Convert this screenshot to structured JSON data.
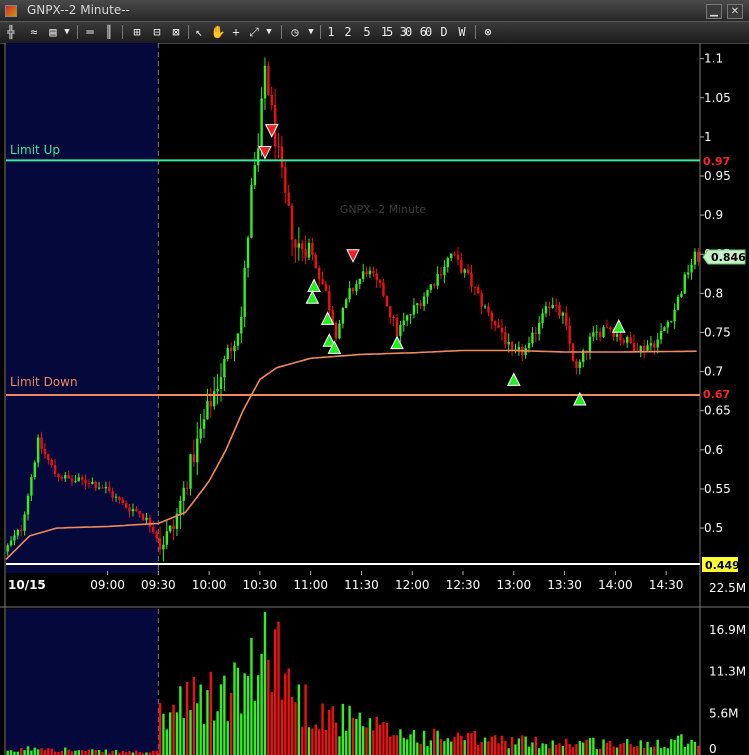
{
  "window": {
    "title": "GNPX--2 Minute--"
  },
  "toolbar": {
    "intervals": [
      "1",
      "2",
      "5",
      "15",
      "30",
      "60",
      "D",
      "W"
    ]
  },
  "colors": {
    "up": "#33ee22",
    "down": "#ee1111",
    "vwap": "#f08a5d",
    "limit_up": "#3ee89a",
    "limit_down": "#f08a5d",
    "session_bg": "#04083a"
  },
  "chart_data": {
    "type": "candlestick",
    "symbol_watermark": "GNPX--2 Minute",
    "date_label": "10/15",
    "x_ticks": [
      "09:00",
      "09:30",
      "10:00",
      "10:30",
      "11:00",
      "11:30",
      "12:00",
      "12:30",
      "13:00",
      "13:30",
      "14:00",
      "14:30"
    ],
    "price_ticks": [
      0.5,
      0.55,
      0.6,
      0.65,
      0.7,
      0.75,
      0.8,
      0.85,
      0.9,
      0.95,
      1,
      1.05,
      1.1
    ],
    "ylim": [
      0.44,
      1.12
    ],
    "volume_ticks": [
      "22.5M",
      "16.9M",
      "11.3M",
      "5.6M",
      "0"
    ],
    "volume_max_m": 22.5,
    "limit_up": {
      "label": "Limit Up",
      "price": 0.97,
      "price_label": "0.97"
    },
    "limit_down": {
      "label": "Limit Down",
      "price": 0.67,
      "price_label": "0.67"
    },
    "last_price": {
      "price": 0.846,
      "label": "0.846"
    },
    "low_marker": {
      "price": 0.449,
      "label": "0.449"
    },
    "path": [
      [
        "08:00",
        0.47
      ],
      [
        "08:10",
        0.5
      ],
      [
        "08:20",
        0.61
      ],
      [
        "08:30",
        0.57
      ],
      [
        "08:40",
        0.56
      ],
      [
        "08:50",
        0.56
      ],
      [
        "09:00",
        0.55
      ],
      [
        "09:10",
        0.53
      ],
      [
        "09:20",
        0.52
      ],
      [
        "09:28",
        0.5
      ],
      [
        "09:32",
        0.48
      ],
      [
        "09:40",
        0.5
      ],
      [
        "09:50",
        0.58
      ],
      [
        "10:00",
        0.65
      ],
      [
        "10:10",
        0.71
      ],
      [
        "10:20",
        0.77
      ],
      [
        "10:26",
        0.93
      ],
      [
        "10:30",
        0.98
      ],
      [
        "10:34",
        1.09
      ],
      [
        "10:40",
        1.0
      ],
      [
        "10:46",
        0.92
      ],
      [
        "10:52",
        0.86
      ],
      [
        "11:00",
        0.86
      ],
      [
        "11:10",
        0.8
      ],
      [
        "11:16",
        0.75
      ],
      [
        "11:24",
        0.8
      ],
      [
        "11:34",
        0.83
      ],
      [
        "11:44",
        0.8
      ],
      [
        "11:52",
        0.75
      ],
      [
        "12:02",
        0.78
      ],
      [
        "12:12",
        0.81
      ],
      [
        "12:24",
        0.85
      ],
      [
        "12:34",
        0.82
      ],
      [
        "12:44",
        0.78
      ],
      [
        "12:54",
        0.75
      ],
      [
        "13:00",
        0.72
      ],
      [
        "13:10",
        0.73
      ],
      [
        "13:20",
        0.79
      ],
      [
        "13:30",
        0.77
      ],
      [
        "13:38",
        0.7
      ],
      [
        "13:46",
        0.74
      ],
      [
        "13:56",
        0.76
      ],
      [
        "14:06",
        0.74
      ],
      [
        "14:16",
        0.73
      ],
      [
        "14:26",
        0.74
      ],
      [
        "14:36",
        0.78
      ],
      [
        "14:44",
        0.83
      ],
      [
        "14:48",
        0.846
      ]
    ],
    "vwap": [
      [
        "08:00",
        0.46
      ],
      [
        "08:14",
        0.49
      ],
      [
        "08:30",
        0.5
      ],
      [
        "09:00",
        0.502
      ],
      [
        "09:30",
        0.506
      ],
      [
        "09:46",
        0.52
      ],
      [
        "10:00",
        0.56
      ],
      [
        "10:10",
        0.6
      ],
      [
        "10:20",
        0.65
      ],
      [
        "10:30",
        0.69
      ],
      [
        "10:40",
        0.705
      ],
      [
        "11:00",
        0.717
      ],
      [
        "11:30",
        0.722
      ],
      [
        "12:00",
        0.724
      ],
      [
        "12:30",
        0.727
      ],
      [
        "13:00",
        0.727
      ],
      [
        "13:30",
        0.725
      ],
      [
        "14:00",
        0.725
      ],
      [
        "14:48",
        0.726
      ]
    ],
    "volume_path": [
      [
        "08:00",
        0.4
      ],
      [
        "08:20",
        1.2
      ],
      [
        "08:40",
        0.6
      ],
      [
        "09:00",
        0.5
      ],
      [
        "09:28",
        0.4
      ],
      [
        "09:30",
        5.5
      ],
      [
        "09:50",
        7.5
      ],
      [
        "10:10",
        8.5
      ],
      [
        "10:30",
        12.0
      ],
      [
        "10:34",
        21.0
      ],
      [
        "10:40",
        14.0
      ],
      [
        "10:50",
        8.0
      ],
      [
        "11:10",
        5.5
      ],
      [
        "11:40",
        3.5
      ],
      [
        "12:10",
        2.5
      ],
      [
        "12:40",
        2.2
      ],
      [
        "13:10",
        1.8
      ],
      [
        "13:40",
        1.8
      ],
      [
        "14:10",
        1.5
      ],
      [
        "14:48",
        2.5
      ]
    ],
    "markers": [
      {
        "type": "sell",
        "time": "10:33",
        "price": 0.98
      },
      {
        "type": "sell",
        "time": "10:37",
        "price": 1.008
      },
      {
        "type": "sell",
        "time": "11:25",
        "price": 0.848
      },
      {
        "type": "buy",
        "time": "11:02",
        "price": 0.81
      },
      {
        "type": "buy",
        "time": "11:01",
        "price": 0.795
      },
      {
        "type": "buy",
        "time": "11:10",
        "price": 0.768
      },
      {
        "type": "buy",
        "time": "11:11",
        "price": 0.74
      },
      {
        "type": "buy",
        "time": "11:14",
        "price": 0.731
      },
      {
        "type": "buy",
        "time": "11:51",
        "price": 0.737
      },
      {
        "type": "buy",
        "time": "13:00",
        "price": 0.69
      },
      {
        "type": "buy",
        "time": "13:39",
        "price": 0.665
      },
      {
        "type": "buy",
        "time": "14:02",
        "price": 0.758
      }
    ]
  }
}
